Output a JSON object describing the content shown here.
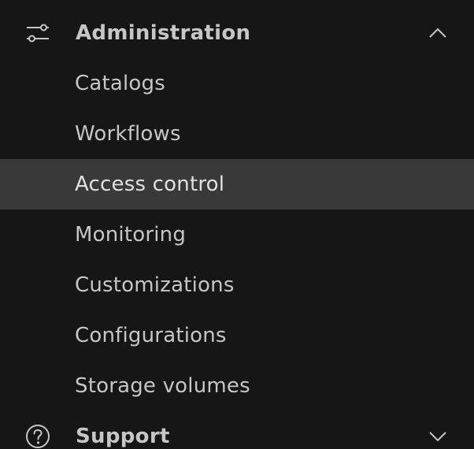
{
  "nav": {
    "administration": {
      "icon": "settings-adjust-icon",
      "title": "Administration",
      "expanded": true,
      "chevron": "chevron-up-icon",
      "items": [
        {
          "label": "Catalogs",
          "active": false
        },
        {
          "label": "Workflows",
          "active": false
        },
        {
          "label": "Access control",
          "active": true
        },
        {
          "label": "Monitoring",
          "active": false
        },
        {
          "label": "Customizations",
          "active": false
        },
        {
          "label": "Configurations",
          "active": false
        },
        {
          "label": "Storage volumes",
          "active": false
        }
      ]
    },
    "support": {
      "icon": "help-icon",
      "title": "Support",
      "expanded": false,
      "chevron": "chevron-down-icon"
    }
  },
  "colors": {
    "background": "#161616",
    "active_background": "#393939",
    "text": "#c6c6c6"
  }
}
